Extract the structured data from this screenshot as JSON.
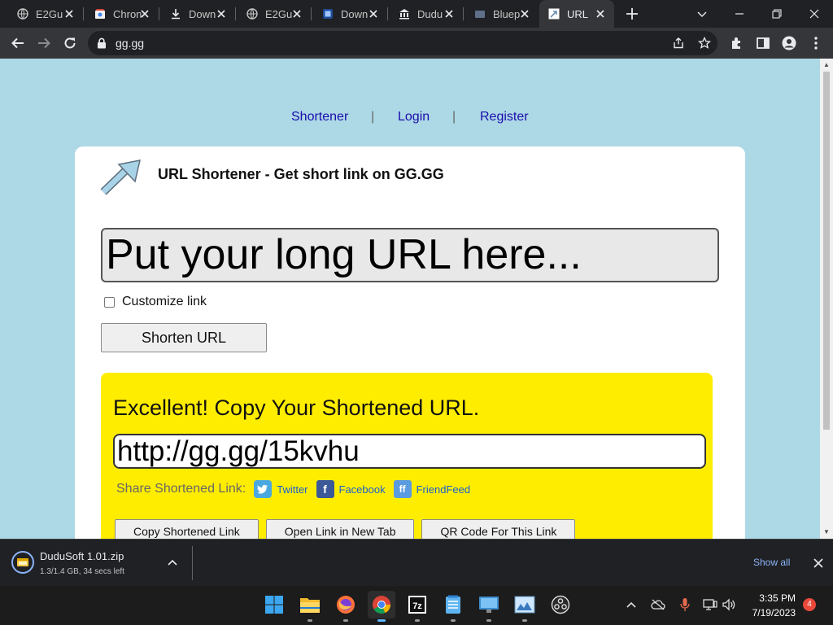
{
  "browser": {
    "tabs": [
      {
        "label": "E2Gu",
        "icon": "globe-icon"
      },
      {
        "label": "Chron",
        "icon": "chrome-store-icon"
      },
      {
        "label": "Down",
        "icon": "download-icon"
      },
      {
        "label": "E2Gu",
        "icon": "globe-icon"
      },
      {
        "label": "Down",
        "icon": "blue-square-icon"
      },
      {
        "label": "Dudu",
        "icon": "bank-icon"
      },
      {
        "label": "Bluep",
        "icon": "page-icon"
      },
      {
        "label": "URL S",
        "icon": "url-shortener-icon",
        "active": true
      }
    ],
    "url": "gg.gg"
  },
  "page": {
    "nav": {
      "shortener": "Shortener",
      "login": "Login",
      "register": "Register",
      "separator": "|"
    },
    "title": "URL Shortener - Get short link on GG.GG",
    "long_url_placeholder": "Put your long URL here...",
    "customize_label": "Customize link",
    "shorten_button": "Shorten URL",
    "result": {
      "heading": "Excellent! Copy Your Shortened URL.",
      "short_url": "http://gg.gg/15kvhu",
      "share_label": "Share Shortened Link:",
      "share_links": {
        "twitter": "Twitter",
        "facebook": "Facebook",
        "friendfeed": "FriendFeed"
      },
      "buttons": {
        "copy": "Copy Shortened Link",
        "open": "Open Link in New Tab",
        "qr": "QR Code For This Link"
      }
    }
  },
  "download_bar": {
    "file_name": "DuduSoft 1.01.zip",
    "status": "1.3/1.4 GB, 34 secs left",
    "show_all": "Show all"
  },
  "taskbar": {
    "time": "3:35 PM",
    "date": "7/19/2023",
    "notification_count": "4"
  },
  "colors": {
    "page_bg": "#add8e6",
    "result_bg": "#ffed00",
    "link": "#1a0dab"
  }
}
